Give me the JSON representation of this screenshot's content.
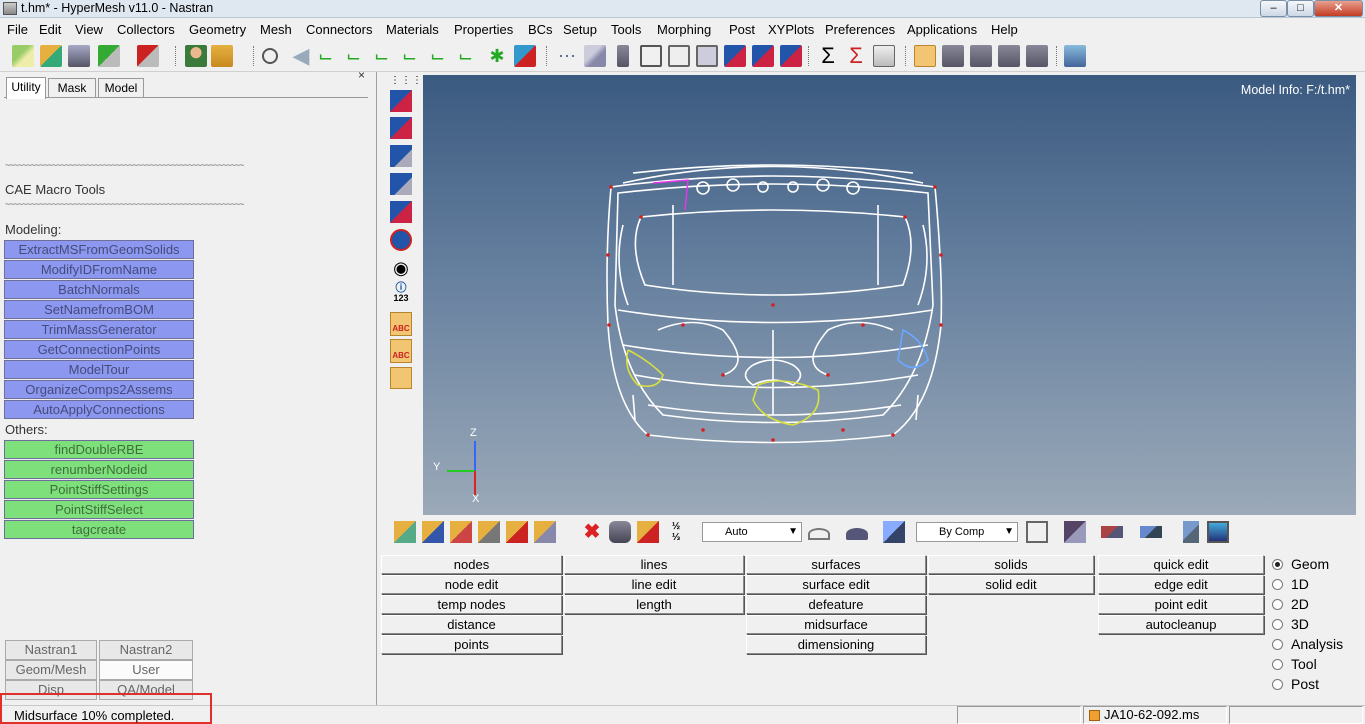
{
  "window": {
    "title": "t.hm* - HyperMesh v11.0 - Nastran"
  },
  "menu": [
    "File",
    "Edit",
    "View",
    "Collectors",
    "Geometry",
    "Mesh",
    "Connectors",
    "Materials",
    "Properties",
    "BCs",
    "Setup",
    "Tools",
    "Morphing",
    "Post",
    "XYPlots",
    "Preferences",
    "Applications",
    "Help"
  ],
  "left_panel": {
    "tabs": [
      "Utility",
      "Mask",
      "Model"
    ],
    "active_tab": "Utility",
    "close_glyph": "×",
    "separator": "~~~~~~~~~~~~~~~~~~~~~~~~~~~~~~~~~~~~~~~~~~~~~~~~~~~~~~~~",
    "section_title": "CAE Macro Tools",
    "modeling_label": "Modeling:",
    "modeling_buttons": [
      "ExtractMSFromGeomSolids",
      "ModifyIDFromName",
      "BatchNormals",
      "SetNamefromBOM",
      "TrimMassGenerator",
      "GetConnectionPoints",
      "ModelTour",
      "OrganizeComps2Assems",
      "AutoApplyConnections"
    ],
    "others_label": "Others:",
    "others_buttons": [
      "findDoubleRBE",
      "renumberNodeid",
      "PointStiffSettings",
      "PointStiffSelect",
      "tagcreate"
    ],
    "bottom_tabs": [
      "Nastran1",
      "Nastran2",
      "Geom/Mesh",
      "User",
      "Disp",
      "QA/Model"
    ]
  },
  "viewport": {
    "model_info": "Model Info: F:/t.hm*",
    "axis_labels": {
      "z": "Z",
      "y": "Y",
      "x": "X"
    }
  },
  "vertical_toolbar": {
    "info_label": "123",
    "abc_label": "ABC"
  },
  "bottom_toolbar": {
    "display_mode": "Auto",
    "color_mode": "By Comp"
  },
  "panel_buttons": {
    "col1": [
      "nodes",
      "node edit",
      "temp nodes",
      "distance",
      "points"
    ],
    "col2": [
      "lines",
      "line edit",
      "length"
    ],
    "col3": [
      "surfaces",
      "surface edit",
      "defeature",
      "midsurface",
      "dimensioning"
    ],
    "col4": [
      "solids",
      "solid edit"
    ],
    "col5": [
      "quick edit",
      "edge edit",
      "point edit",
      "autocleanup"
    ]
  },
  "page_modes": {
    "options": [
      "Geom",
      "1D",
      "2D",
      "3D",
      "Analysis",
      "Tool",
      "Post"
    ],
    "selected": "Geom"
  },
  "status": {
    "message": "Midsurface 10% completed.",
    "file": "JA10-62-092.ms"
  },
  "colors": {
    "viewport_top": "#3b5a80",
    "viewport_bottom": "#9ba9b8",
    "macro_blue": "#8c98f0",
    "macro_green": "#7ee07a",
    "highlight_red": "#e0302a"
  }
}
